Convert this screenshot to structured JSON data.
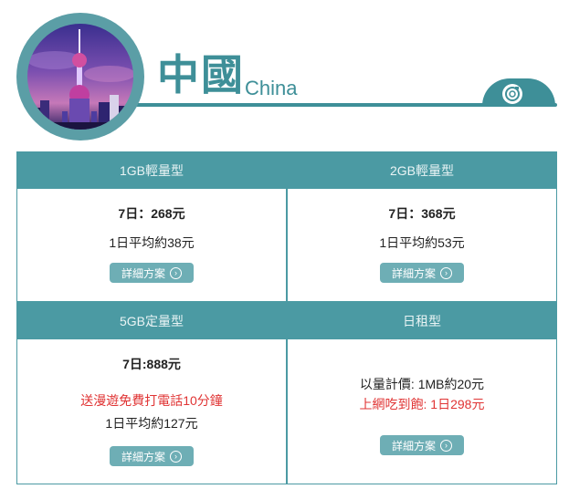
{
  "header": {
    "title_zh": "中國",
    "title_en": "China",
    "badge_icon": "camera-lens-icon",
    "photo_icon": "shanghai-skyline-photo"
  },
  "colors": {
    "accent": "#3e8f98",
    "card_header": "#4b9aa3",
    "button": "#6eaeb5",
    "highlight_red": "#e03434"
  },
  "plans": [
    {
      "name": "1GB輕量型",
      "price": "7日：268元",
      "daily": "1日平均約38元",
      "button": "詳細方案"
    },
    {
      "name": "2GB輕量型",
      "price": "7日：368元",
      "daily": "1日平均約53元",
      "button": "詳細方案"
    },
    {
      "name": "5GB定量型",
      "price": "7日:888元",
      "promo": "送漫遊免費打電話10分鐘",
      "daily": "1日平均約127元",
      "button": "詳細方案"
    },
    {
      "name": "日租型",
      "usage": "以量計價: 1MB約20元",
      "unlimited": "上網吃到飽: 1日298元",
      "button": "詳細方案"
    }
  ]
}
